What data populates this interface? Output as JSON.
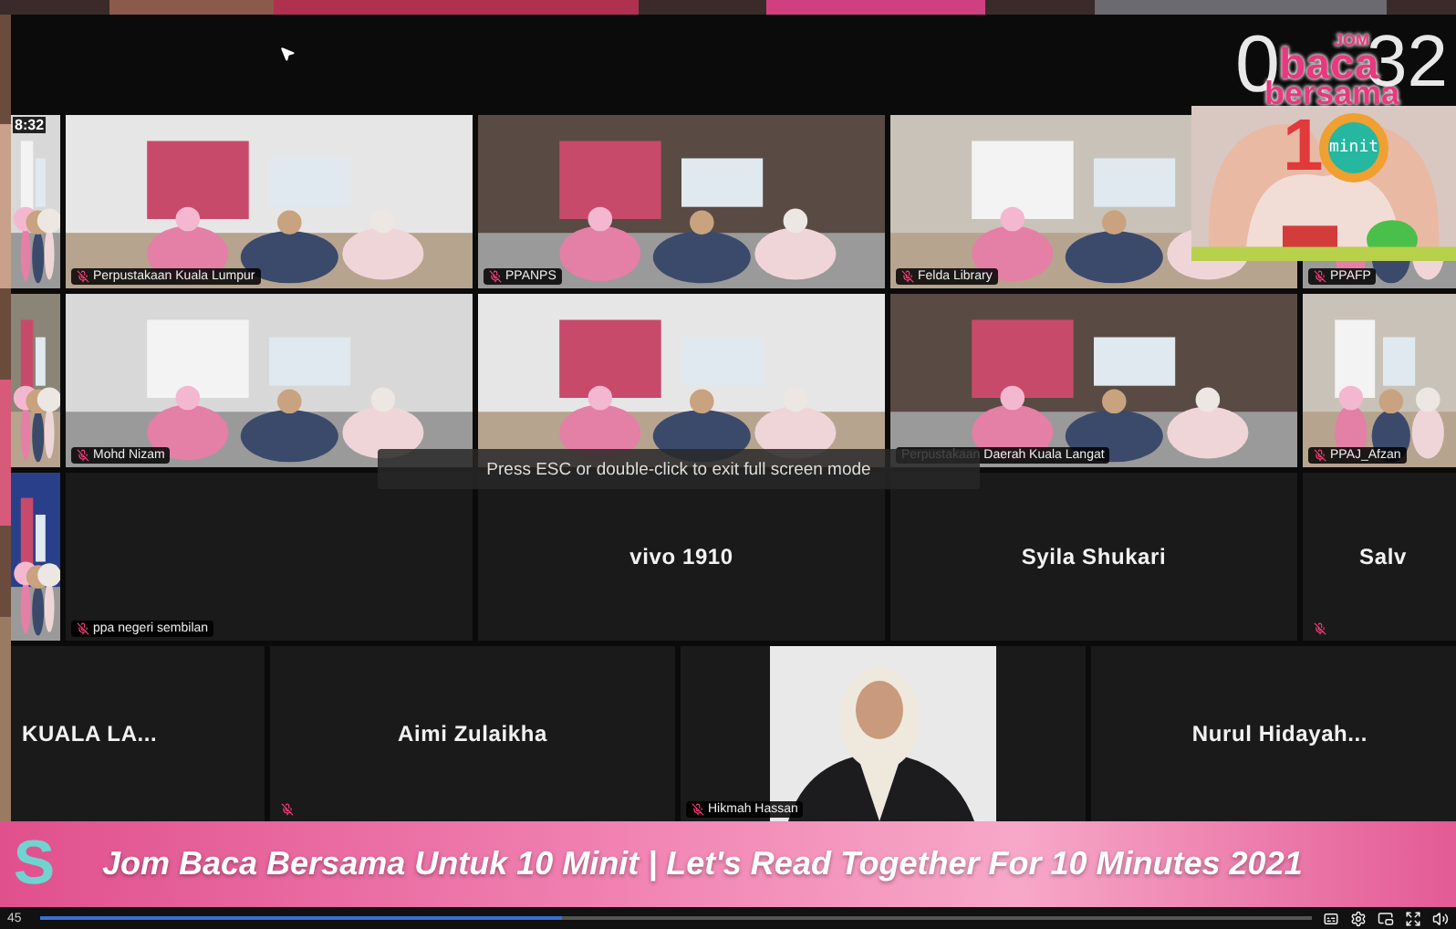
{
  "meeting": {
    "fullscreen_hint": "Press ESC or double-click to exit full screen mode",
    "rows": [
      {
        "tiles": [
          {
            "kind": "video",
            "clock": "8:32"
          },
          {
            "kind": "video",
            "label": "Perpustakaan Kuala Lumpur",
            "muted": true
          },
          {
            "kind": "video",
            "label": "PPANPS",
            "muted": true
          },
          {
            "kind": "video",
            "label": "Felda Library",
            "muted": true
          },
          {
            "kind": "video",
            "label": "PPAFP",
            "muted": true
          }
        ]
      },
      {
        "tiles": [
          {
            "kind": "video"
          },
          {
            "kind": "video",
            "label": "Mohd Nizam",
            "muted": true
          },
          {
            "kind": "video"
          },
          {
            "kind": "video",
            "label": "Perpustakaan Daerah Kuala Langat",
            "muted": false
          },
          {
            "kind": "video",
            "label": "PPAJ_Afzan",
            "muted": true
          }
        ]
      },
      {
        "tiles": [
          {
            "kind": "video"
          },
          {
            "kind": "blank",
            "label": "ppa negeri sembilan",
            "muted": true
          },
          {
            "kind": "name",
            "name": "vivo 1910",
            "muted": false
          },
          {
            "kind": "name",
            "name": "Syila Shukari",
            "muted": false
          },
          {
            "kind": "name",
            "name": "Salv",
            "muted": true
          }
        ]
      },
      {
        "tiles": [
          {
            "kind": "name",
            "name": "KUALA LA...",
            "muted": false
          },
          {
            "kind": "name",
            "name": "Aimi Zulaikha",
            "muted": true
          },
          {
            "label": "Hikmah Hassan",
            "muted": true
          },
          {
            "kind": "name",
            "name": "Nurul  Hidayah...",
            "muted": false
          }
        ]
      }
    ]
  },
  "logo": {
    "clock": [
      "0",
      "32"
    ],
    "small": "JOM",
    "line1": "baca",
    "line2": "bersama",
    "number": "1",
    "badge": "minit"
  },
  "banner": {
    "logo": "S",
    "title": "Jom Baca Bersama Untuk 10 Minit | Let's Read Together For 10 Minutes 2021"
  },
  "player": {
    "time": "45",
    "level": 0.41
  }
}
